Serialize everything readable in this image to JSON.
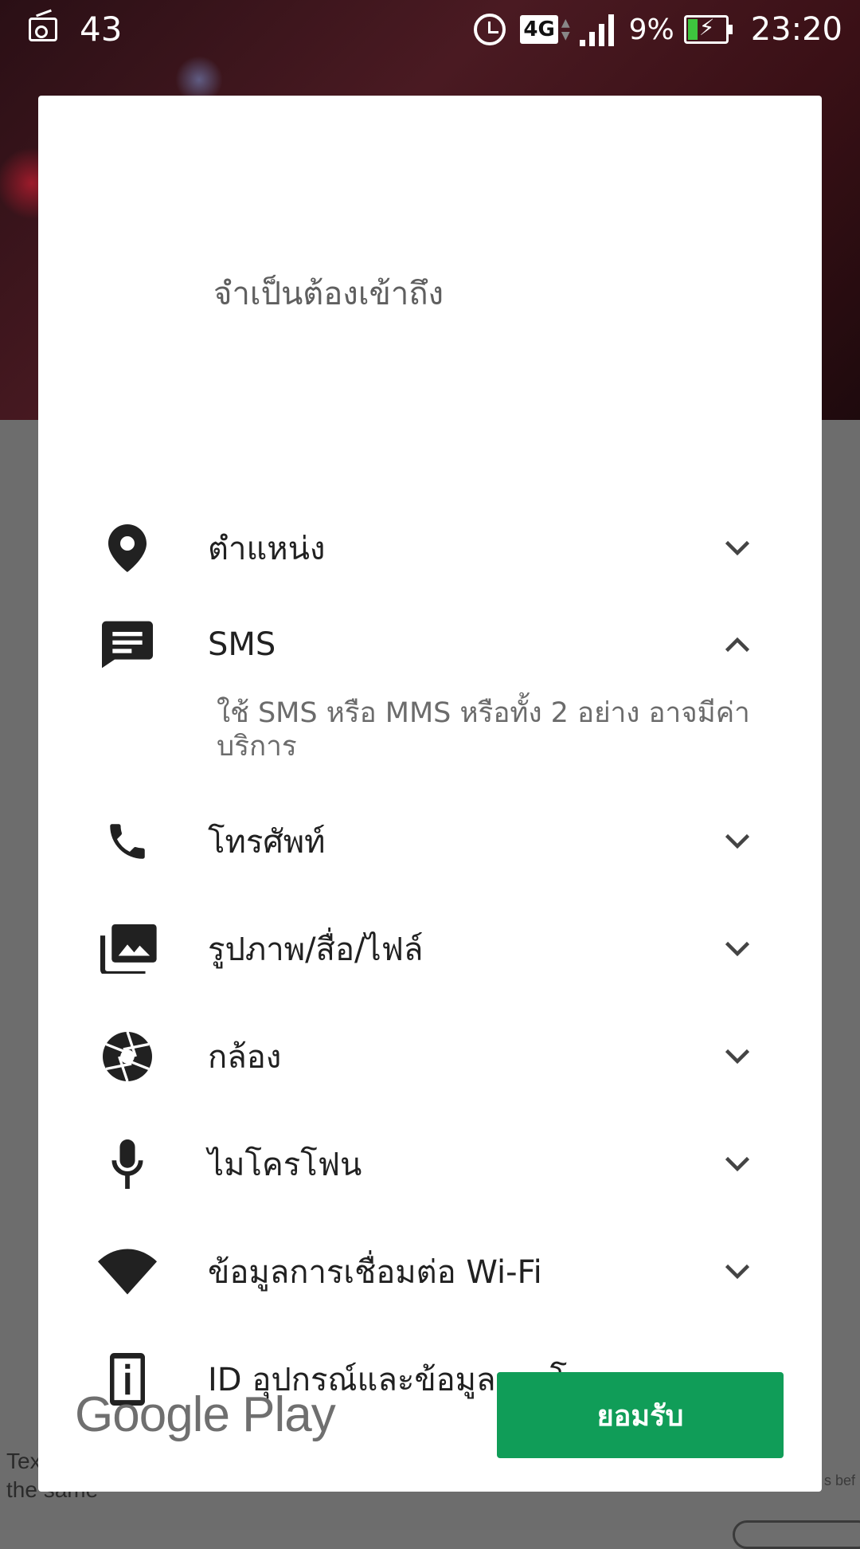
{
  "status_bar": {
    "left_number": "43",
    "network": "4G",
    "battery_percent": "9%",
    "time": "23:20"
  },
  "background": {
    "text_lines": [
      "Tex",
      "the same"
    ],
    "right_snippet": "s bef"
  },
  "dialog": {
    "title": "จำเป็นต้องเข้าถึง",
    "permissions": [
      {
        "label": "ตำแหน่ง",
        "icon": "location-pin-icon",
        "expanded": false
      },
      {
        "label": "SMS",
        "icon": "message-icon",
        "expanded": true,
        "description": "ใช้ SMS หรือ MMS หรือทั้ง 2 อย่าง อาจมีค่าบริการ"
      },
      {
        "label": "โทรศัพท์",
        "icon": "phone-icon",
        "expanded": false
      },
      {
        "label": "รูปภาพ/สื่อ/ไฟล์",
        "icon": "photo-library-icon",
        "expanded": false
      },
      {
        "label": "กล้อง",
        "icon": "camera-aperture-icon",
        "expanded": false
      },
      {
        "label": "ไมโครโฟน",
        "icon": "microphone-icon",
        "expanded": false
      },
      {
        "label": "ข้อมูลการเชื่อมต่อ Wi-Fi",
        "icon": "wifi-icon",
        "expanded": false
      },
      {
        "label": "ID อุปกรณ์และข้อมูลการโทร",
        "icon": "device-info-icon",
        "expanded": false
      }
    ],
    "footer_logo": "Google Play",
    "accept_label": "ยอมรับ",
    "accent_color": "#109d58"
  }
}
